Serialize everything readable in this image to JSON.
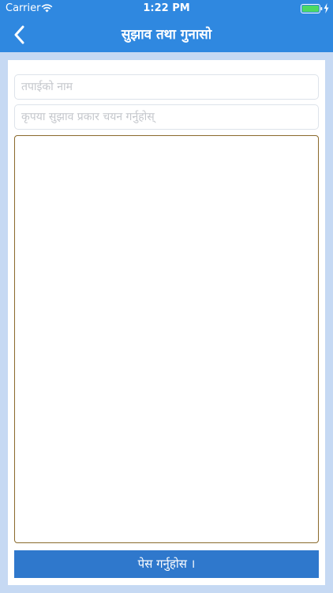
{
  "status_bar": {
    "carrier": "Carrier",
    "time": "1:22 PM",
    "icons": [
      "wifi-icon",
      "battery-icon",
      "charging-icon"
    ]
  },
  "nav": {
    "title": "सुझाव तथा गुनासो",
    "back_icon": "chevron-left-icon"
  },
  "form": {
    "name_placeholder": "तपाईको नाम",
    "type_placeholder": "कृपया सुझाव प्रकार चयन गर्नुहोस्",
    "message_value": "",
    "submit_label": "पेस गर्नुहोस ।"
  },
  "colors": {
    "header": "#2f88e0",
    "background": "#c6d9f3",
    "submit": "#2f78cc",
    "message_border": "#8a6a2c"
  }
}
